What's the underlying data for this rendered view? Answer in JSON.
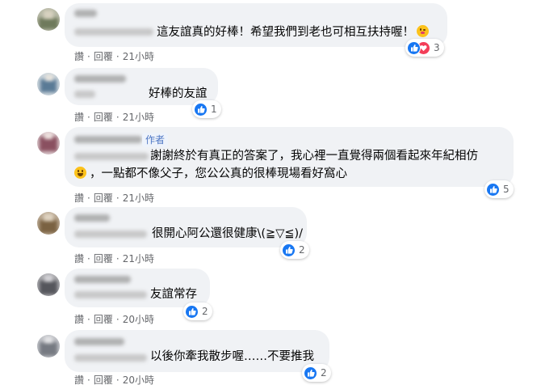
{
  "actions": {
    "like_label": "讚",
    "reply_label": "回覆",
    "separator": "·"
  },
  "author_badge": "作者",
  "colors": {
    "accent": "#1877f2",
    "bubble": "#f0f2f5",
    "love": "#f33e58",
    "muted": "#65676b"
  },
  "comments": [
    {
      "text": "這友誼真的好棒！希望我們到老也可相互扶持喔！",
      "emoji": "winking-face-icon",
      "time": "21小時",
      "reaction_count": "3",
      "reactions": [
        "like",
        "love"
      ]
    },
    {
      "text": "好棒的友誼",
      "time": "21小時",
      "reaction_count": "1",
      "reactions": [
        "like"
      ]
    },
    {
      "lines": [
        "謝謝終於有真正的答案了，我心裡一直覺得兩個看起來年紀相仿",
        "，一點都不像父子，您公公真的很棒現場看好窩心"
      ],
      "emoji": "grinning-sweat-face-icon",
      "time": "21小時",
      "reaction_count": "5",
      "reactions": [
        "like"
      ],
      "is_author": true
    },
    {
      "text": "很開心阿公還很健康\\(≧▽≦)/",
      "time": "21小時",
      "reaction_count": "2",
      "reactions": [
        "like"
      ]
    },
    {
      "text": "友誼常存",
      "time": "20小時",
      "reaction_count": "2",
      "reactions": [
        "like"
      ]
    },
    {
      "text": "以後你牽我散步喔……不要推我",
      "time": "20小時",
      "reaction_count": "2",
      "reactions": [
        "like"
      ]
    }
  ]
}
